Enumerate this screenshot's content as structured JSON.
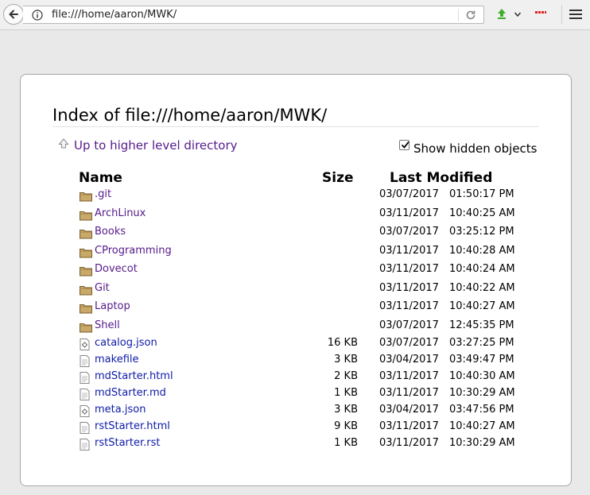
{
  "browser": {
    "url": "file:///home/aaron/MWK/"
  },
  "page": {
    "title": "Index of file:///home/aaron/MWK/",
    "up_link": "Up to higher level directory",
    "show_hidden_label": "Show hidden objects",
    "show_hidden_checked": true,
    "columns": {
      "name": "Name",
      "size": "Size",
      "modified": "Last Modified"
    }
  },
  "entries": [
    {
      "name": ".git",
      "type": "folder",
      "size": "",
      "date": "03/07/2017",
      "time": "01:50:17 PM"
    },
    {
      "name": "ArchLinux",
      "type": "folder",
      "size": "",
      "date": "03/11/2017",
      "time": "10:40:25 AM"
    },
    {
      "name": "Books",
      "type": "folder",
      "size": "",
      "date": "03/07/2017",
      "time": "03:25:12 PM"
    },
    {
      "name": "CProgramming",
      "type": "folder",
      "size": "",
      "date": "03/11/2017",
      "time": "10:40:28 AM"
    },
    {
      "name": "Dovecot",
      "type": "folder",
      "size": "",
      "date": "03/11/2017",
      "time": "10:40:24 AM"
    },
    {
      "name": "Git",
      "type": "folder",
      "size": "",
      "date": "03/11/2017",
      "time": "10:40:22 AM"
    },
    {
      "name": "Laptop",
      "type": "folder",
      "size": "",
      "date": "03/11/2017",
      "time": "10:40:27 AM"
    },
    {
      "name": "Shell",
      "type": "folder",
      "size": "",
      "date": "03/07/2017",
      "time": "12:45:35 PM"
    },
    {
      "name": "catalog.json",
      "type": "json",
      "size": "16 KB",
      "date": "03/07/2017",
      "time": "03:27:25 PM"
    },
    {
      "name": "makefile",
      "type": "file",
      "size": "3 KB",
      "date": "03/04/2017",
      "time": "03:49:47 PM"
    },
    {
      "name": "mdStarter.html",
      "type": "file",
      "size": "2 KB",
      "date": "03/11/2017",
      "time": "10:40:30 AM"
    },
    {
      "name": "mdStarter.md",
      "type": "file",
      "size": "1 KB",
      "date": "03/11/2017",
      "time": "10:30:29 AM"
    },
    {
      "name": "meta.json",
      "type": "json",
      "size": "3 KB",
      "date": "03/04/2017",
      "time": "03:47:56 PM"
    },
    {
      "name": "rstStarter.html",
      "type": "file",
      "size": "9 KB",
      "date": "03/11/2017",
      "time": "10:40:27 AM"
    },
    {
      "name": "rstStarter.rst",
      "type": "file",
      "size": "1 KB",
      "date": "03/11/2017",
      "time": "10:30:29 AM"
    }
  ]
}
